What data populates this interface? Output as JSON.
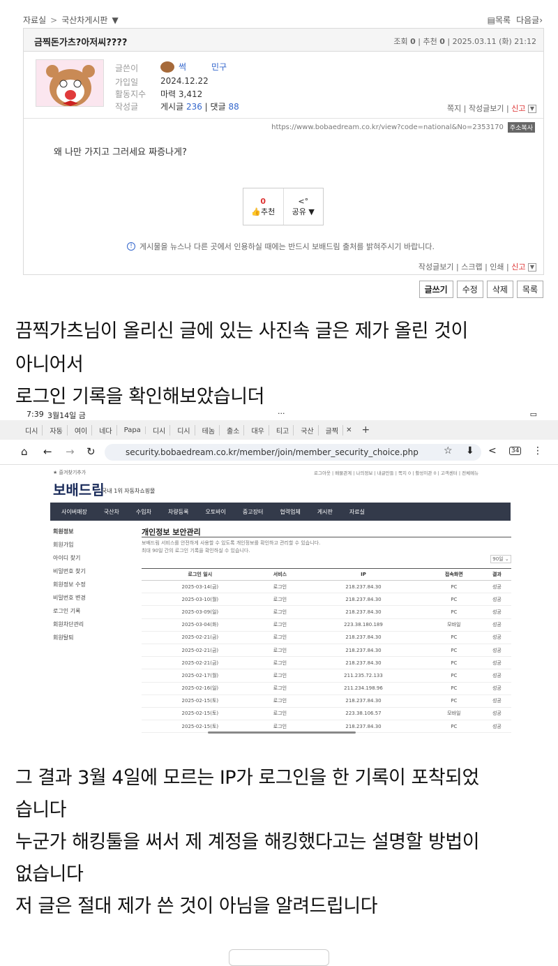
{
  "breadcrumb": {
    "root": "자료실",
    "current": "국산차게시판"
  },
  "top_nav": {
    "list": "목록",
    "next": "다음글"
  },
  "post": {
    "title": "금찍돈가츠?아저씨????",
    "views_label": "조회",
    "views": "0",
    "recommend_label": "추천",
    "recommend": "0",
    "datetime": "2025.03.11 (화) 21:12",
    "author_label": "글쓴이",
    "author": "썩",
    "author_tag": "민구",
    "joined_label": "가입일",
    "joined": "2024.12.22",
    "activity_label": "활동지수",
    "activity": "마력 3,412",
    "writings_label": "작성글",
    "posts_label": "게시글",
    "posts": "236",
    "comments_label": "댓글",
    "comments": "88",
    "user_links": [
      "쪽지",
      "작성글보기",
      "신고"
    ],
    "url": "https://www.bobaedream.co.kr/view?code=national&No=2353170",
    "copy_label": "주소복사",
    "body": "왜 나만 가지고 그러세요 짜증나게?",
    "rec_count": "0",
    "rec_label": "추천",
    "share_label": "공유",
    "notice": "게시물을 뉴스나 다른 곳에서 인용하실 때에는 반드시 보배드림 출처를 밝혀주시기 바랍니다.",
    "bottom_links": [
      "작성글보기",
      "스크랩",
      "인쇄",
      "신고"
    ]
  },
  "actions": [
    "글쓰기",
    "수정",
    "삭제",
    "목록"
  ],
  "text1": [
    "끔찍가츠님이 올리신 글에 있는 사진속 글은 제가 올린 것이",
    "아니어서",
    "로그인 기록을 확인해보았습니더"
  ],
  "screenshot": {
    "time": "7:39",
    "date": "3월14일 금",
    "tabs": [
      "디시",
      "자동",
      "여이",
      "네다",
      "Papa",
      "디시",
      "디시",
      "테놈",
      "출소",
      "대우",
      "티고",
      "국산",
      "글찍"
    ],
    "url": "security.bobaedream.co.kr/member/join/member_security_choice.php",
    "tab_count": "34",
    "bookmark": "즐겨찾기추가",
    "top_links": "로그아웃 | 배물관계 | 나의정보 | 내글만들 | 쪽지 0 | 활성이관 0 | 고객센터 | 전체메뉴",
    "logo": "보배드림",
    "logo_sub": "국내 1위 자동차쇼핑몰",
    "nav": [
      "사이버매장",
      "국산차",
      "수입차",
      "차량등록",
      "오토바이",
      "중고장터",
      "협력업체",
      "게시판",
      "자료실"
    ],
    "sidebar": [
      "회원정보",
      "회원가입",
      "아이디 찾기",
      "비밀번호 찾기",
      "회원정보 수정",
      "비밀번호 변경",
      "로그인 기록",
      "회원차단관리",
      "회원탈퇴"
    ],
    "section_title": "개인정보 보안관리",
    "desc1": "보배드림 서비스를 안전하게 사용할 수 있도록 개인정보를 확인하고 관리할 수 있습니다.",
    "desc2": "최대 90일 간의 로그인 기록을 확인하실 수 있습니다.",
    "days": "90일",
    "headers": [
      "로그인 일시",
      "서비스",
      "IP",
      "접속화면",
      "결과"
    ],
    "rows": [
      [
        "2025-03-14(금)",
        "로그인",
        "218.237.84.30",
        "PC",
        "성공"
      ],
      [
        "2025-03-10(월)",
        "로그인",
        "218.237.84.30",
        "PC",
        "성공"
      ],
      [
        "2025-03-09(일)",
        "로그인",
        "218.237.84.30",
        "PC",
        "성공"
      ],
      [
        "2025-03-04(화)",
        "로그인",
        "223.38.180.189",
        "모바일",
        "성공"
      ],
      [
        "2025-02-21(금)",
        "로그인",
        "218.237.84.30",
        "PC",
        "성공"
      ],
      [
        "2025-02-21(금)",
        "로그인",
        "218.237.84.30",
        "PC",
        "성공"
      ],
      [
        "2025-02-21(금)",
        "로그인",
        "218.237.84.30",
        "PC",
        "성공"
      ],
      [
        "2025-02-17(월)",
        "로그인",
        "211.235.72.133",
        "PC",
        "성공"
      ],
      [
        "2025-02-16(일)",
        "로그인",
        "211.234.198.96",
        "PC",
        "성공"
      ],
      [
        "2025-02-15(토)",
        "로그인",
        "218.237.84.30",
        "PC",
        "성공"
      ],
      [
        "2025-02-15(토)",
        "로그인",
        "223.38.106.57",
        "모바일",
        "성공"
      ],
      [
        "2025-02-15(토)",
        "로그인",
        "218.237.84.30",
        "PC",
        "성공"
      ]
    ]
  },
  "text2": [
    "그 결과 3월 4일에 모르는 IP가 로그인을 한 기록이 포착되었",
    "습니다",
    "누군가 해킹툴을 써서 제 계정을 해킹했다고는 설명할 방법이",
    "없습니다",
    "저 글은 절대 제가 쓴 것이 아님을 알려드립니다"
  ]
}
